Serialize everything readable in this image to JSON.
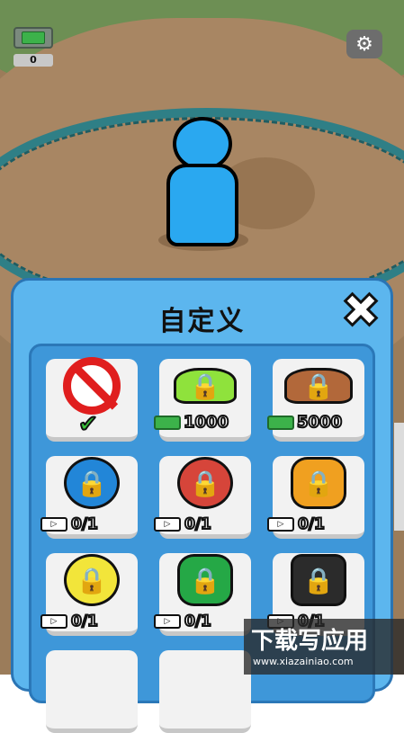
{
  "hud": {
    "money_count": "0",
    "settings_icon": "gear-icon",
    "money_icon": "money-icon"
  },
  "panel": {
    "title": "自定义",
    "close_icon": "close-icon"
  },
  "items": [
    {
      "kind": "none",
      "status_icon": "check-icon"
    },
    {
      "kind": "price",
      "price": "1000",
      "icon": "green-hat-locked"
    },
    {
      "kind": "price",
      "price": "5000",
      "icon": "brown-hat-locked"
    },
    {
      "kind": "ad",
      "progress": "0/1",
      "icon": "blue-crown-mask-locked"
    },
    {
      "kind": "ad",
      "progress": "0/1",
      "icon": "red-mask-locked"
    },
    {
      "kind": "ad",
      "progress": "0/1",
      "icon": "orange-dino-mask-locked"
    },
    {
      "kind": "ad",
      "progress": "0/1",
      "icon": "yellow-mask-locked"
    },
    {
      "kind": "ad",
      "progress": "0/1",
      "icon": "green-mask-locked"
    },
    {
      "kind": "ad",
      "progress": "0/1",
      "icon": "black-mask-locked"
    }
  ],
  "watermark": {
    "main": "下载写应用",
    "sub": "www.xiazainiao.com"
  },
  "colors": {
    "panel_bg": "#5cb6ee",
    "inner_bg": "#3e97d9",
    "player": "#2aa8f0"
  }
}
